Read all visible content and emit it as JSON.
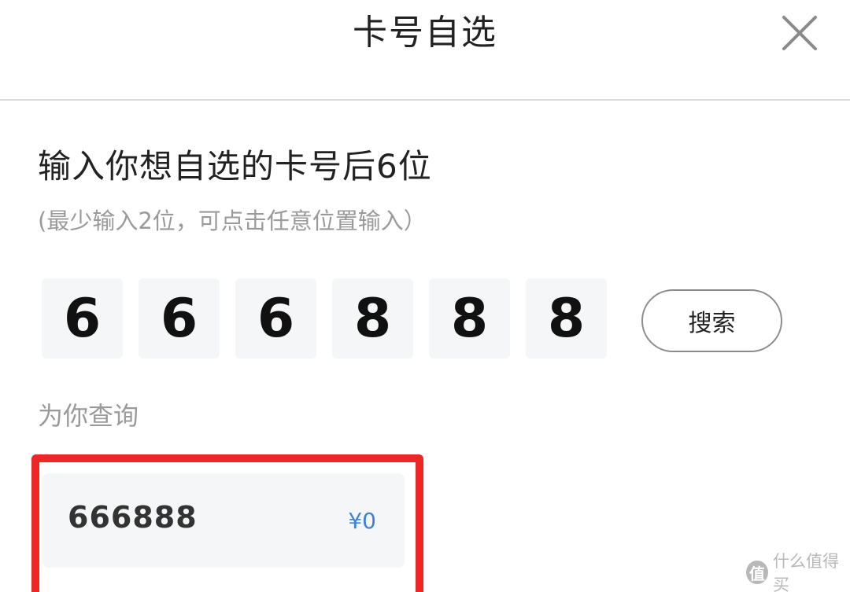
{
  "header": {
    "title": "卡号自选",
    "close_icon": "close-icon"
  },
  "prompt": {
    "heading": "输入你想自选的卡号后6位",
    "subheading": "(最少输入2位，可点击任意位置输入）"
  },
  "digits": [
    "6",
    "6",
    "6",
    "8",
    "8",
    "8"
  ],
  "search_button": {
    "label": "搜索"
  },
  "results": {
    "label": "为你查询",
    "items": [
      {
        "number": "666888",
        "price": "¥0"
      }
    ]
  },
  "colors": {
    "highlight": "#ee2626",
    "price": "#3d82d8",
    "digit_box_bg": "#f4f6f8"
  },
  "watermark": {
    "logo": "值",
    "text": "什么值得买"
  }
}
